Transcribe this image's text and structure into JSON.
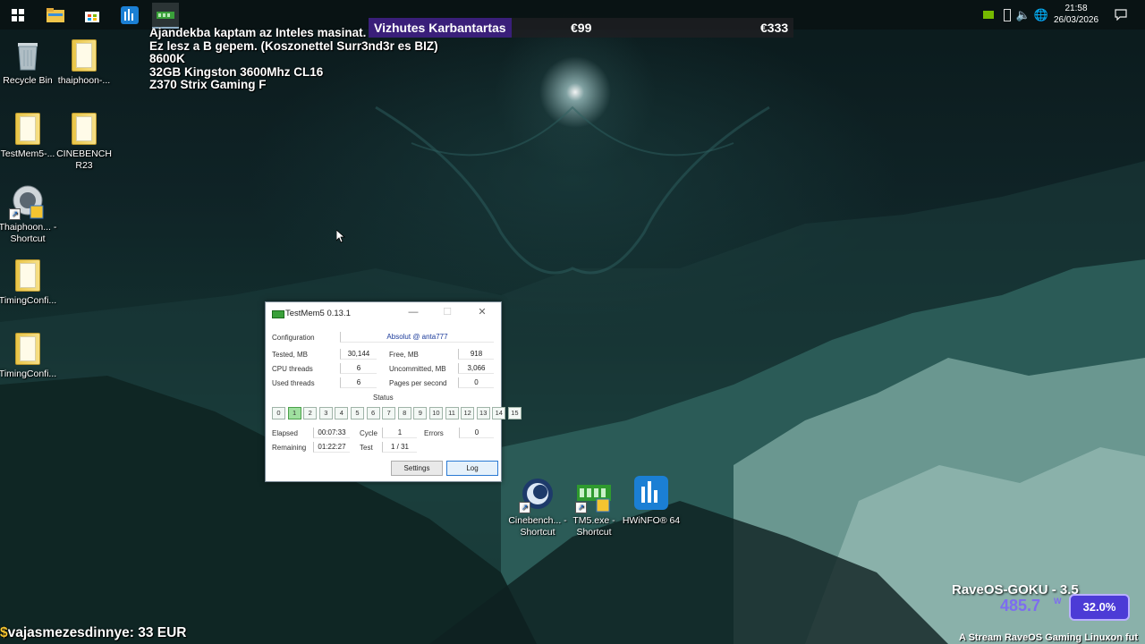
{
  "taskbar": {
    "icons": [
      "windows-start-icon",
      "file-explorer-icon",
      "microsoft-store-icon",
      "hwinfo-taskbar-icon",
      "testmem5-taskbar-icon"
    ],
    "clock_time": "21:58",
    "clock_date": "26/03/2026"
  },
  "stream_banner": {
    "title": "Vizhutes Karbantartas",
    "price1": "€99",
    "price2": "€333"
  },
  "stream_note": {
    "lines": [
      "Ajandekba kaptam az Inteles masinat.",
      "Ez lesz a B gepem. (Koszonettel Surr3nd3r es BIZ)",
      "8600K",
      "32GB Kingston 3600Mhz CL16",
      "Z370 Strix Gaming F"
    ]
  },
  "desktop_icons": [
    {
      "label": "Recycle Bin"
    },
    {
      "label": "thaiphoon-..."
    },
    {
      "label": "TestMem5-..."
    },
    {
      "label": "CINEBENCH R23"
    },
    {
      "label": "Thaiphoon... - Shortcut"
    },
    {
      "label": "TimingConfi..."
    },
    {
      "label": "TimingConfi..."
    },
    {
      "label": "Cinebench... - Shortcut"
    },
    {
      "label": "TM5.exe - Shortcut"
    },
    {
      "label": "HWiNFO® 64"
    }
  ],
  "testmem5": {
    "title": "TestMem5  0.13.1",
    "configuration_label": "Configuration",
    "configuration_value": "Absolut @ anta777",
    "tested_label": "Tested, MB",
    "tested_value": "30,144",
    "free_label": "Free, MB",
    "free_value": "918",
    "cpu_threads_label": "CPU threads",
    "cpu_threads_value": "6",
    "uncommitted_label": "Uncommitted, MB",
    "uncommitted_value": "3,066",
    "used_threads_label": "Used threads",
    "used_threads_value": "6",
    "pps_label": "Pages per second",
    "pps_value": "0",
    "status_label": "Status",
    "status_cells": [
      "0",
      "1",
      "2",
      "3",
      "4",
      "5",
      "6",
      "7",
      "8",
      "9",
      "10",
      "11",
      "12",
      "13",
      "14",
      "15"
    ],
    "active_cell": "1",
    "elapsed_label": "Elapsed",
    "elapsed_value": "00:07:33",
    "cycle_label": "Cycle",
    "cycle_value": "1",
    "errors_label": "Errors",
    "errors_value": "0",
    "remaining_label": "Remaining",
    "remaining_value": "01:22:27",
    "test_label": "Test",
    "test_value": "1 / 31",
    "settings_button": "Settings",
    "log_button": "Log"
  },
  "donation": {
    "text": "vajasmezesdinnye: 33 EUR"
  },
  "raveos": {
    "name": "RaveOS-GOKU - 3.5",
    "power_value": "485.7",
    "power_unit": "W",
    "percent": "32.0%"
  },
  "footer_ticker": {
    "text": "A Stream RaveOS Gaming Linuxon fut"
  },
  "colors": {
    "accent": "#4c3bd6",
    "banner": "#3a1f7a",
    "active_cell": "#9fe09f"
  }
}
